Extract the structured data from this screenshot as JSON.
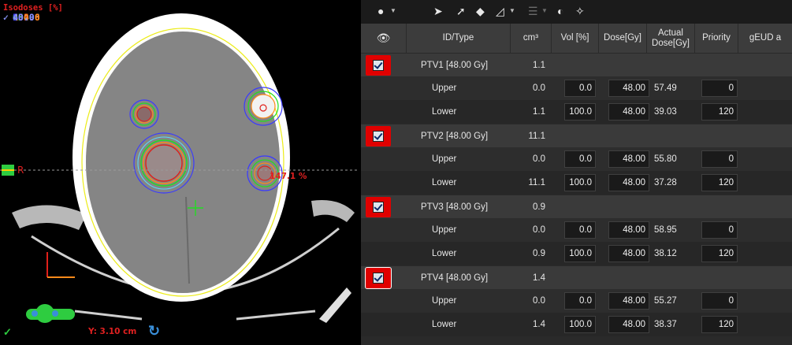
{
  "viewer": {
    "isodose_title": "Isodoses [%]",
    "isodoses": [
      {
        "check": "✓",
        "value": "134.6",
        "color": "#b8b8b8"
      },
      {
        "check": "✓",
        "value": "105.0",
        "color": "#e0201a"
      },
      {
        "check": "✓",
        "value": "100.0",
        "color": "#ff8a1a"
      },
      {
        "check": "✓",
        "value": "95.0",
        "color": "#22dd22"
      },
      {
        "check": "✓",
        "value": "90.0",
        "color": "#1e8f1e"
      },
      {
        "check": "✓",
        "value": "80.0",
        "color": "#f2f21a"
      },
      {
        "check": "✓",
        "value": "60.0",
        "color": "#5ad8ff"
      },
      {
        "check": "✓",
        "value": "50.0",
        "color": "#3a3aff"
      },
      {
        "check": "✓",
        "value": "40.0",
        "color": "#8a8aff"
      }
    ],
    "orientation_label": "R",
    "max_dose_label": "147.1 %",
    "y_readout": "Y: 3.10 cm",
    "check_mark": "✓"
  },
  "toolbar": {
    "icons": [
      "plan-selector-icon",
      "arrow-right-icon",
      "arrow-up-right-icon",
      "diamond-icon",
      "chart-icon",
      "beam-icon",
      "sphere-icon",
      "scissors-icon"
    ]
  },
  "table": {
    "columns": {
      "visibility": "",
      "id_type": "ID/Type",
      "volume": "cm³",
      "vol_pct": "Vol [%]",
      "dose": "Dose[Gy]",
      "actual_dose": "Actual Dose[Gy]",
      "priority": "Priority",
      "geud": "gEUD a"
    },
    "structures": [
      {
        "name": "PTV1 [48.00 Gy]",
        "volume": "1.1",
        "selected": false,
        "constraints": [
          {
            "type": "Upper",
            "volume": "0.0",
            "vol_pct": "0.0",
            "dose": "48.00",
            "actual": "57.49",
            "priority": "0"
          },
          {
            "type": "Lower",
            "volume": "1.1",
            "vol_pct": "100.0",
            "dose": "48.00",
            "actual": "39.03",
            "priority": "120"
          }
        ]
      },
      {
        "name": "PTV2 [48.00 Gy]",
        "volume": "11.1",
        "selected": false,
        "constraints": [
          {
            "type": "Upper",
            "volume": "0.0",
            "vol_pct": "0.0",
            "dose": "48.00",
            "actual": "55.80",
            "priority": "0"
          },
          {
            "type": "Lower",
            "volume": "11.1",
            "vol_pct": "100.0",
            "dose": "48.00",
            "actual": "37.28",
            "priority": "120"
          }
        ]
      },
      {
        "name": "PTV3 [48.00 Gy]",
        "volume": "0.9",
        "selected": false,
        "constraints": [
          {
            "type": "Upper",
            "volume": "0.0",
            "vol_pct": "0.0",
            "dose": "48.00",
            "actual": "58.95",
            "priority": "0"
          },
          {
            "type": "Lower",
            "volume": "0.9",
            "vol_pct": "100.0",
            "dose": "48.00",
            "actual": "38.12",
            "priority": "120"
          }
        ]
      },
      {
        "name": "PTV4 [48.00 Gy]",
        "volume": "1.4",
        "selected": true,
        "constraints": [
          {
            "type": "Upper",
            "volume": "0.0",
            "vol_pct": "0.0",
            "dose": "48.00",
            "actual": "55.27",
            "priority": "0"
          },
          {
            "type": "Lower",
            "volume": "1.4",
            "vol_pct": "100.0",
            "dose": "48.00",
            "actual": "38.37",
            "priority": "120"
          }
        ]
      }
    ]
  }
}
